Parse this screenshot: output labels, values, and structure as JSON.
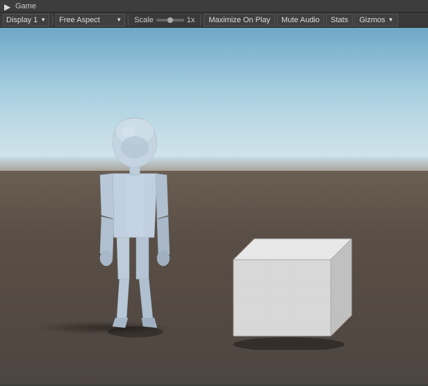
{
  "titlebar": {
    "label": "Game",
    "icon": "▶"
  },
  "toolbar": {
    "display_label": "Display 1",
    "aspect_label": "Free Aspect",
    "scale_label": "Scale",
    "scale_value": "1x",
    "maximize_label": "Maximize On Play",
    "mute_label": "Mute Audio",
    "stats_label": "Stats",
    "gizmos_label": "Gizmos"
  }
}
